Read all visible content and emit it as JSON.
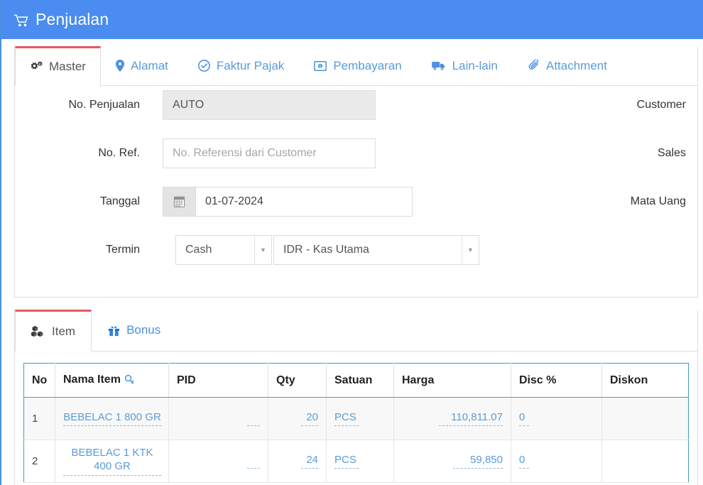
{
  "header": {
    "title": "Penjualan",
    "icon": "shopping-cart-icon",
    "background": "#4a8cf0"
  },
  "master_tabs": [
    {
      "label": "Master",
      "icon": "gears-icon",
      "active": true
    },
    {
      "label": "Alamat",
      "icon": "map-marker-icon",
      "active": false
    },
    {
      "label": "Faktur Pajak",
      "icon": "check-circle-icon",
      "active": false
    },
    {
      "label": "Pembayaran",
      "icon": "money-icon",
      "active": false
    },
    {
      "label": "Lain-lain",
      "icon": "truck-icon",
      "active": false
    },
    {
      "label": "Attachment",
      "icon": "paperclip-icon",
      "active": false
    }
  ],
  "form": {
    "no_penjualan": {
      "label": "No. Penjualan",
      "value": "AUTO",
      "readonly": true
    },
    "no_ref": {
      "label": "No. Ref.",
      "value": "",
      "placeholder": "No. Referensi dari Customer"
    },
    "tanggal": {
      "label": "Tanggal",
      "value": "01-07-2024",
      "icon": "calendar-icon"
    },
    "termin": {
      "label": "Termin",
      "value": "Cash"
    },
    "kas": {
      "value": "IDR - Kas Utama"
    },
    "customer": {
      "label": "Customer"
    },
    "sales": {
      "label": "Sales"
    },
    "mata_uang": {
      "label": "Mata Uang"
    }
  },
  "item_tabs": [
    {
      "label": "Item",
      "icon": "cubes-icon",
      "active": true
    },
    {
      "label": "Bonus",
      "icon": "gift-icon",
      "active": false
    }
  ],
  "grid": {
    "search_icon": "search-icon",
    "columns": [
      {
        "key": "no",
        "label": "No",
        "align": "left"
      },
      {
        "key": "nama",
        "label": "Nama Item",
        "align": "left",
        "has_search": true
      },
      {
        "key": "pid",
        "label": "PID",
        "align": "left"
      },
      {
        "key": "qty",
        "label": "Qty",
        "align": "left"
      },
      {
        "key": "satuan",
        "label": "Satuan",
        "align": "left"
      },
      {
        "key": "harga",
        "label": "Harga",
        "align": "left"
      },
      {
        "key": "disc",
        "label": "Disc %",
        "align": "left"
      },
      {
        "key": "diskon",
        "label": "Diskon",
        "align": "left"
      }
    ],
    "rows": [
      {
        "no": "1",
        "nama": "BEBELAC 1 800 GR",
        "pid": "",
        "qty": "20",
        "satuan": "PCS",
        "harga": "110,811.07",
        "disc": "0",
        "diskon": ""
      },
      {
        "no": "2",
        "nama": "BEBELAC 1 KTK 400 GR",
        "pid": "",
        "qty": "24",
        "satuan": "PCS",
        "harga": "59,850",
        "disc": "0",
        "diskon": ""
      }
    ]
  },
  "colors": {
    "header_blue": "#4a8cf0",
    "tab_link": "#5a9bd8",
    "active_tab_bar": "#e8595e",
    "grid_border": "#3f9dbb",
    "cell_text": "#5b9bd5"
  }
}
